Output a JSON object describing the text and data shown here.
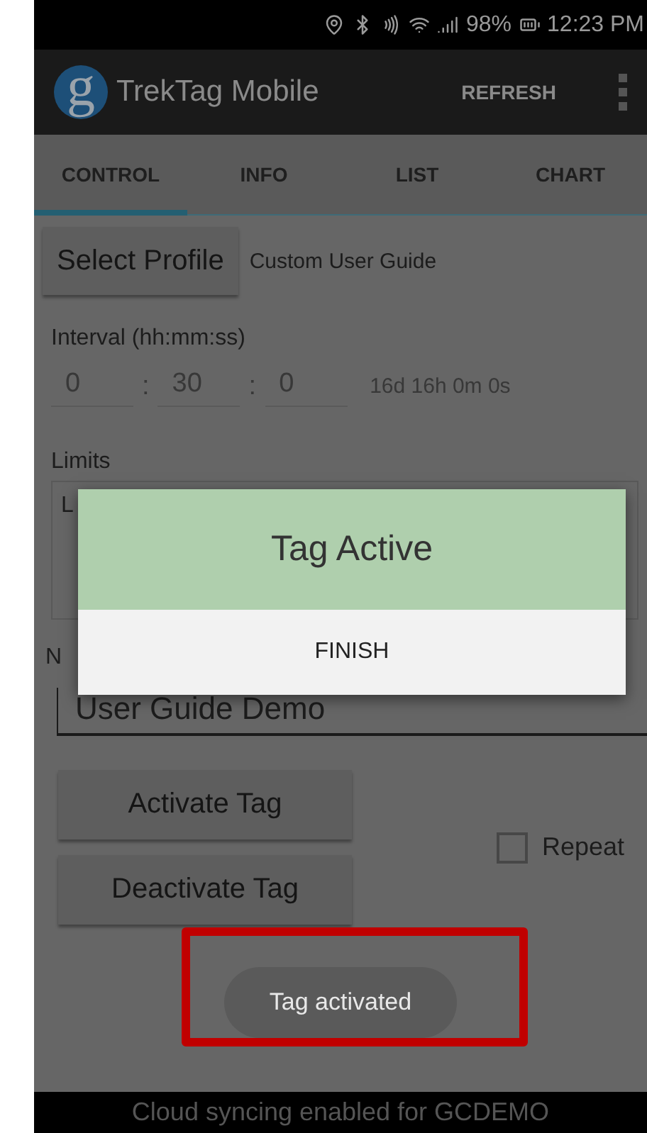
{
  "status_bar": {
    "battery": "98%",
    "time": "12:23 PM"
  },
  "app_bar": {
    "logo": "g",
    "title": "TrekTag Mobile",
    "action": "REFRESH"
  },
  "tabs": [
    {
      "label": "CONTROL",
      "selected": true
    },
    {
      "label": "INFO",
      "selected": false
    },
    {
      "label": "LIST",
      "selected": false
    },
    {
      "label": "CHART",
      "selected": false
    }
  ],
  "profile": {
    "button": "Select Profile",
    "value": "Custom User Guide"
  },
  "interval": {
    "label": "Interval (hh:mm:ss)",
    "fields": [
      "0",
      "30",
      "0"
    ],
    "separators": [
      ":",
      ":"
    ],
    "duration": "16d 16h 0m 0s"
  },
  "limits": {
    "label": "Limits",
    "text": "L"
  },
  "notes": {
    "label": "N",
    "value": "User Guide Demo"
  },
  "buttons": [
    "Activate Tag",
    "Deactivate Tag"
  ],
  "repeat": {
    "label": "Repeat",
    "checked": false
  },
  "toast": {
    "text": "Tag activated",
    "highlighted": true
  },
  "dialog": {
    "title": "Tag Active",
    "button": "FINISH"
  },
  "footer": "Cloud syncing enabled for GCDEMO"
}
